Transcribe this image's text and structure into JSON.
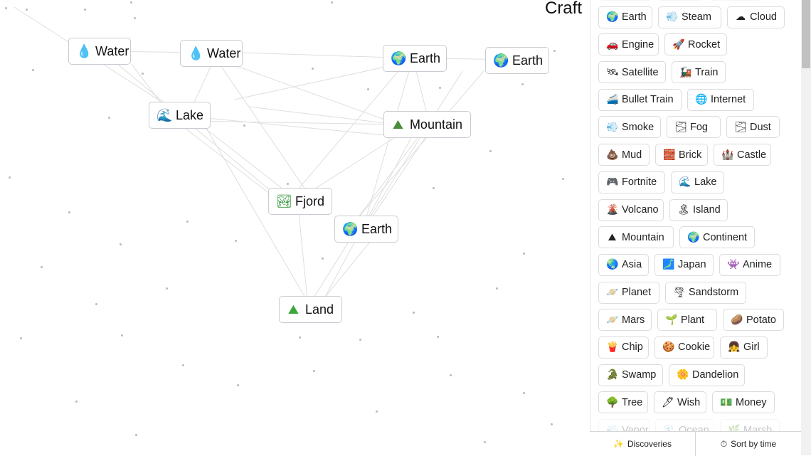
{
  "title": {
    "text": "Craft"
  },
  "canvas": {
    "nodes": [
      {
        "label": "Water",
        "icon": "water-drop-icon",
        "glyph": "💧",
        "color": "#1a9fe0"
      },
      {
        "label": "Water",
        "icon": "water-drop-icon",
        "glyph": "💧",
        "color": "#1a9fe0"
      },
      {
        "label": "Earth",
        "icon": "earth-globe-icon",
        "glyph": "🌍",
        "color": "#2f8f3a"
      },
      {
        "label": "Earth",
        "icon": "earth-globe-icon",
        "glyph": "🌍",
        "color": "#2f8f3a"
      },
      {
        "label": "Lake",
        "icon": "wave-icon",
        "glyph": "🌊",
        "color": "#2a8fc4"
      },
      {
        "label": "Mountain",
        "icon": "mountain-icon",
        "glyph": "⛰",
        "color": "#4a8d3a"
      },
      {
        "label": "Fjord",
        "icon": "fjord-icon",
        "glyph": "🏞",
        "color": "#3a9a40"
      },
      {
        "label": "Earth",
        "icon": "earth-globe-icon",
        "glyph": "🌍",
        "color": "#2f8f3a"
      },
      {
        "label": "Land",
        "icon": "land-icon",
        "glyph": "⛰",
        "color": "#3ba63a"
      }
    ]
  },
  "sidebar": {
    "rows": [
      [
        {
          "label": "",
          "glyph": "",
          "icon": "partial-item-icon"
        },
        {
          "label": "",
          "glyph": "",
          "icon": "partial-item-icon"
        },
        {
          "label": "",
          "glyph": "",
          "icon": "partial-item-icon"
        }
      ],
      [
        {
          "label": "Earth",
          "glyph": "🌍",
          "icon": "earth-globe-icon"
        },
        {
          "label": "Steam",
          "glyph": "💨",
          "icon": "steam-icon"
        },
        {
          "label": "Cloud",
          "glyph": "☁",
          "icon": "cloud-icon"
        }
      ],
      [
        {
          "label": "Engine",
          "glyph": "🚗",
          "icon": "car-icon"
        },
        {
          "label": "Rocket",
          "glyph": "🚀",
          "icon": "rocket-icon"
        }
      ],
      [
        {
          "label": "Satellite",
          "glyph": "🛰",
          "icon": "satellite-icon"
        },
        {
          "label": "Train",
          "glyph": "🚂",
          "icon": "train-icon"
        }
      ],
      [
        {
          "label": "Bullet Train",
          "glyph": "🚄",
          "icon": "bullet-train-icon"
        },
        {
          "label": "Internet",
          "glyph": "🌐",
          "icon": "globe-grid-icon"
        }
      ],
      [
        {
          "label": "Smoke",
          "glyph": "💨",
          "icon": "smoke-icon"
        },
        {
          "label": "Fog",
          "glyph": "🌫",
          "icon": "fog-icon"
        },
        {
          "label": "Dust",
          "glyph": "🌫",
          "icon": "dust-icon"
        }
      ],
      [
        {
          "label": "Mud",
          "glyph": "💩",
          "icon": "mud-icon"
        },
        {
          "label": "Brick",
          "glyph": "🧱",
          "icon": "brick-icon"
        },
        {
          "label": "Castle",
          "glyph": "🏰",
          "icon": "castle-icon"
        }
      ],
      [
        {
          "label": "Fortnite",
          "glyph": "🎮",
          "icon": "game-controller-icon"
        },
        {
          "label": "Lake",
          "glyph": "🌊",
          "icon": "wave-icon"
        }
      ],
      [
        {
          "label": "Volcano",
          "glyph": "🌋",
          "icon": "volcano-icon"
        },
        {
          "label": "Island",
          "glyph": "🏝",
          "icon": "island-icon"
        }
      ],
      [
        {
          "label": "Mountain",
          "glyph": "⛰",
          "icon": "mountain-icon"
        },
        {
          "label": "Continent",
          "glyph": "🌍",
          "icon": "earth-globe-icon"
        }
      ],
      [
        {
          "label": "Asia",
          "glyph": "🌏",
          "icon": "earth-globe-icon"
        },
        {
          "label": "Japan",
          "glyph": "🗾",
          "icon": "japan-map-icon"
        },
        {
          "label": "Anime",
          "glyph": "👾",
          "icon": "monster-icon"
        }
      ],
      [
        {
          "label": "Planet",
          "glyph": "🪐",
          "icon": "planet-icon"
        },
        {
          "label": "Sandstorm",
          "glyph": "🌪",
          "icon": "tornado-icon"
        }
      ],
      [
        {
          "label": "Mars",
          "glyph": "🪐",
          "icon": "planet-icon"
        },
        {
          "label": "Plant",
          "glyph": "🌱",
          "icon": "seedling-icon"
        },
        {
          "label": "Potato",
          "glyph": "🥔",
          "icon": "potato-icon"
        }
      ],
      [
        {
          "label": "Chip",
          "glyph": "🍟",
          "icon": "fries-icon"
        },
        {
          "label": "Cookie",
          "glyph": "🍪",
          "icon": "cookie-icon"
        },
        {
          "label": "Girl",
          "glyph": "👧",
          "icon": "girl-icon"
        }
      ],
      [
        {
          "label": "Swamp",
          "glyph": "🐊",
          "icon": "swamp-icon"
        },
        {
          "label": "Dandelion",
          "glyph": "🌼",
          "icon": "flower-icon"
        }
      ],
      [
        {
          "label": "Tree",
          "glyph": "🌳",
          "icon": "tree-icon"
        },
        {
          "label": "Wish",
          "glyph": "🖊",
          "icon": "wish-icon"
        },
        {
          "label": "Money",
          "glyph": "💵",
          "icon": "money-icon"
        }
      ],
      [
        {
          "label": "Vapor",
          "glyph": "💨",
          "icon": "partial-item-icon"
        },
        {
          "label": "Ocean",
          "glyph": "🌊",
          "icon": "partial-item-icon"
        },
        {
          "label": "Marsh",
          "glyph": "🌿",
          "icon": "partial-item-icon"
        }
      ]
    ],
    "bottom_bar": {
      "discoveries_label": "Discoveries",
      "sort_label": "Sort by time"
    }
  }
}
